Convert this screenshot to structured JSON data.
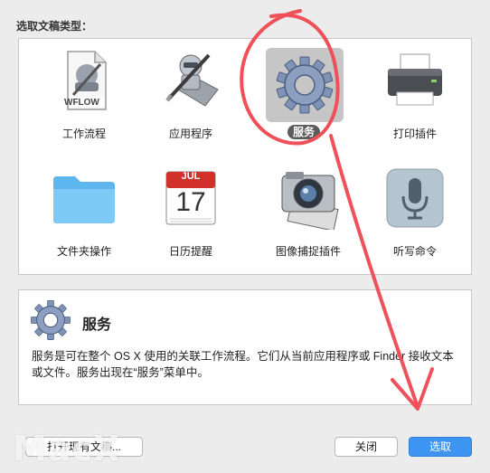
{
  "dialog": {
    "prompt": "选取文稿类型：",
    "items": [
      {
        "label": "工作流程",
        "icon": "workflow-document-icon",
        "badge": "WFLOW"
      },
      {
        "label": "应用程序",
        "icon": "automator-robot-icon"
      },
      {
        "label": "服务",
        "icon": "gear-icon",
        "selected": true
      },
      {
        "label": "打印插件",
        "icon": "printer-icon"
      },
      {
        "label": "文件夹操作",
        "icon": "folder-icon"
      },
      {
        "label": "日历提醒",
        "icon": "calendar-icon",
        "month": "JUL",
        "day": "17"
      },
      {
        "label": "图像捕捉插件",
        "icon": "image-capture-icon"
      },
      {
        "label": "听写命令",
        "icon": "microphone-icon"
      }
    ],
    "description": {
      "title": "服务",
      "text": "服务是可在整个 OS X 使用的关联工作流程。它们从当前应用程序或 Finder 接收文本或文件。服务出现在“服务”菜单中。"
    },
    "buttons": {
      "open_existing": "打开现有文稿...",
      "close": "关闭",
      "choose": "选取"
    }
  },
  "annotation": {
    "color": "#f0505a"
  },
  "watermark": "MacX"
}
